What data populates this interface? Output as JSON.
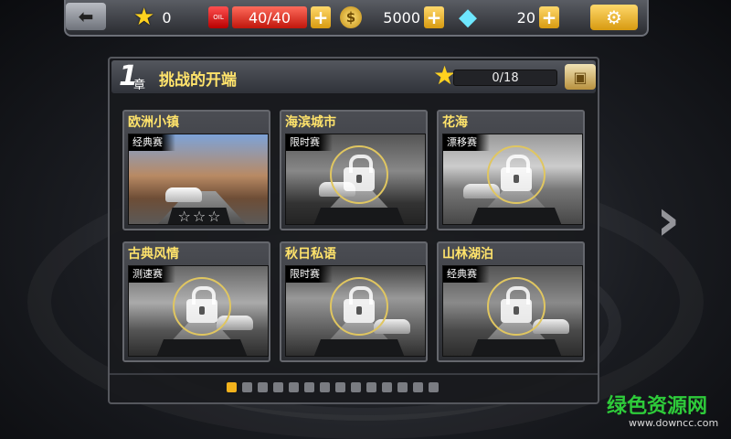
{
  "topbar": {
    "stars": "0",
    "fuel": "40/40",
    "fuel_icon_label": "OIL",
    "coins": "5000",
    "coin_symbol": "$",
    "diamonds": "20"
  },
  "chapter": {
    "number": "1",
    "unit": "章",
    "title": "挑战的开端",
    "progress": "0/18"
  },
  "tracks": [
    {
      "name": "欧洲小镇",
      "mode": "经典赛",
      "locked": false,
      "stars": "☆☆☆"
    },
    {
      "name": "海滨城市",
      "mode": "限时赛",
      "locked": true
    },
    {
      "name": "花海",
      "mode": "漂移赛",
      "locked": true
    },
    {
      "name": "古典风情",
      "mode": "测速赛",
      "locked": true
    },
    {
      "name": "秋日私语",
      "mode": "限时赛",
      "locked": true
    },
    {
      "name": "山林湖泊",
      "mode": "经典赛",
      "locked": true
    }
  ],
  "pagination": {
    "total": 14,
    "current": 1
  },
  "watermark": {
    "cn": "绿色资源网",
    "url": "www.downcc.com"
  },
  "colors": {
    "accent_gold": "#ffd21f",
    "title_yellow": "#ffe36b",
    "active_dot": "#f2b21c"
  }
}
